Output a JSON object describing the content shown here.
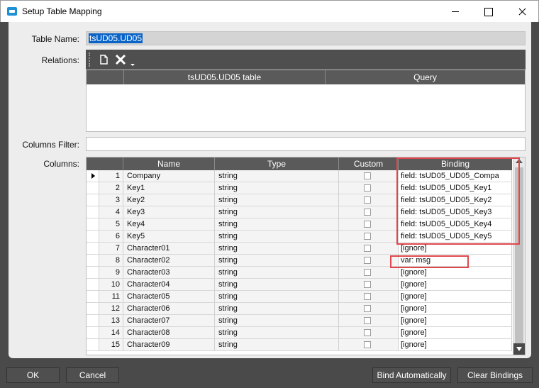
{
  "window": {
    "title": "Setup Table Mapping"
  },
  "labels": {
    "table_name": "Table Name:",
    "relations": "Relations:",
    "columns_filter": "Columns Filter:",
    "columns": "Columns:"
  },
  "table_name": {
    "value": "tsUD05.UD05"
  },
  "relations": {
    "toolbar_icons": [
      "copy-icon",
      "delete-icon",
      "dropdown-icon"
    ],
    "headers": [
      "tsUD05.UD05 table",
      "Query"
    ]
  },
  "columns_filter": {
    "value": ""
  },
  "columns_grid": {
    "headers": [
      "Name",
      "Type",
      "Custom",
      "Binding"
    ],
    "rows": [
      {
        "num": "1",
        "name": "Company",
        "type": "string",
        "binding": "field: tsUD05_UD05_Compa"
      },
      {
        "num": "2",
        "name": "Key1",
        "type": "string",
        "binding": "field: tsUD05_UD05_Key1"
      },
      {
        "num": "3",
        "name": "Key2",
        "type": "string",
        "binding": "field: tsUD05_UD05_Key2"
      },
      {
        "num": "4",
        "name": "Key3",
        "type": "string",
        "binding": "field: tsUD05_UD05_Key3"
      },
      {
        "num": "5",
        "name": "Key4",
        "type": "string",
        "binding": "field: tsUD05_UD05_Key4"
      },
      {
        "num": "6",
        "name": "Key5",
        "type": "string",
        "binding": "field: tsUD05_UD05_Key5"
      },
      {
        "num": "7",
        "name": "Character01",
        "type": "string",
        "binding": "[ignore]"
      },
      {
        "num": "8",
        "name": "Character02",
        "type": "string",
        "binding": "var: msg"
      },
      {
        "num": "9",
        "name": "Character03",
        "type": "string",
        "binding": "[ignore]"
      },
      {
        "num": "10",
        "name": "Character04",
        "type": "string",
        "binding": "[ignore]"
      },
      {
        "num": "11",
        "name": "Character05",
        "type": "string",
        "binding": "[ignore]"
      },
      {
        "num": "12",
        "name": "Character06",
        "type": "string",
        "binding": "[ignore]"
      },
      {
        "num": "13",
        "name": "Character07",
        "type": "string",
        "binding": "[ignore]"
      },
      {
        "num": "14",
        "name": "Character08",
        "type": "string",
        "binding": "[ignore]"
      },
      {
        "num": "15",
        "name": "Character09",
        "type": "string",
        "binding": "[ignore]"
      }
    ]
  },
  "buttons": {
    "ok": "OK",
    "cancel": "Cancel",
    "bind_auto": "Bind Automatically",
    "clear": "Clear Bindings"
  },
  "colors": {
    "highlight": "#e0474c",
    "grid_header": "#5a5a5a",
    "selection": "#0a64c8"
  }
}
